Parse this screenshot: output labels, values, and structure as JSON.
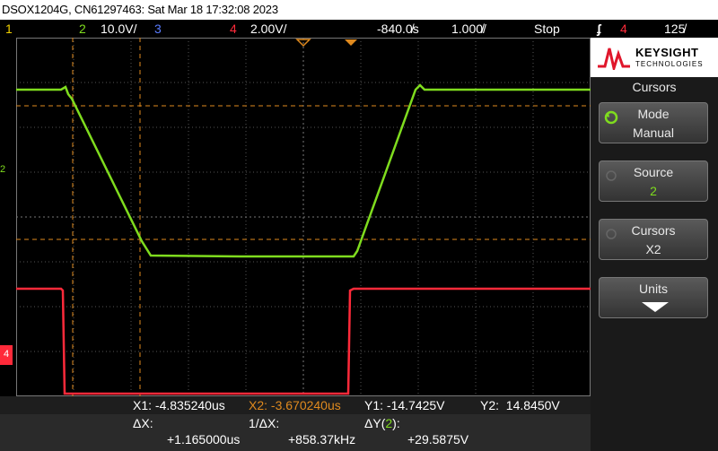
{
  "title_bar": "DSOX1204G, CN61297463: Sat Mar 18 17:32:08 2023",
  "status": {
    "ch1_num": "1",
    "ch2_num": "2",
    "ch2_scale": "10.0V/",
    "ch3_num": "3",
    "ch4_num": "4",
    "ch4_scale": "2.00V/",
    "delay": "-840.0̸s",
    "timebase": "1.000̸/",
    "run_state": "Stop",
    "trig_source": "4",
    "trig_level": "125̸"
  },
  "colors": {
    "ch1": "#f0d000",
    "ch2": "#7fdc1e",
    "ch3": "#5a7cff",
    "ch4": "#ff2a3a",
    "cursor": "#e08a1e",
    "grid": "#555555"
  },
  "markers": {
    "ch2_marker": "2",
    "ch4_marker": "4"
  },
  "brand": {
    "name": "KEYSIGHT",
    "sub": "TECHNOLOGIES"
  },
  "menu": {
    "title": "Cursors",
    "keys": [
      {
        "label": "Mode",
        "value": "Manual",
        "icon": "rotate-icon"
      },
      {
        "label": "Source",
        "value": "2",
        "icon": "rotate-icon"
      },
      {
        "label": "Cursors",
        "value": "X2",
        "icon": "rotate-icon"
      },
      {
        "label": "Units",
        "value": "",
        "icon": "down-arrow-icon"
      }
    ]
  },
  "readout": {
    "x1": "X1: -4.835240us",
    "x2": "X2: -3.670240us",
    "y1": "Y1: -14.7425V",
    "y2": "Y2:  14.8450V",
    "dx_label": "ΔX:",
    "dx_value": "+1.165000us",
    "inv_dx_label": "1/ΔX:",
    "inv_dx_value": "+858.37kHz",
    "dy_label": "ΔY(",
    "dy_source": "2",
    "dy_close": "):",
    "dy_value": "+29.5875V"
  }
}
